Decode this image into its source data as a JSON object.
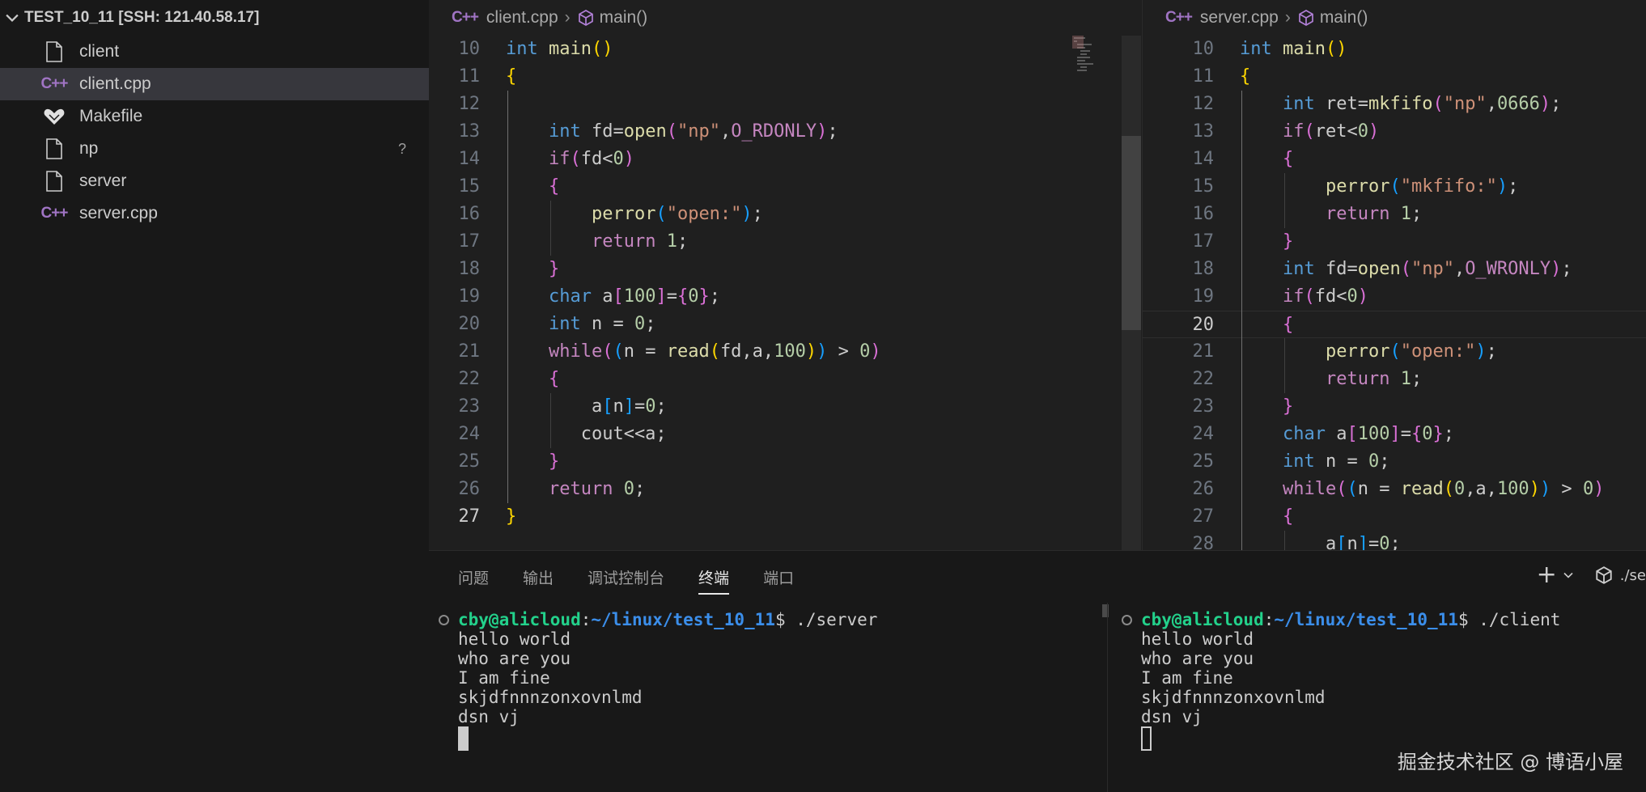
{
  "explorer": {
    "folder_title": "TEST_10_11 [SSH: 121.40.58.17]",
    "files": [
      {
        "name": "client",
        "icon": "file-icon"
      },
      {
        "name": "client.cpp",
        "icon": "cpp-icon"
      },
      {
        "name": "Makefile",
        "icon": "makefile-icon"
      },
      {
        "name": "np",
        "icon": "file-icon",
        "status": "?"
      },
      {
        "name": "server",
        "icon": "file-icon"
      },
      {
        "name": "server.cpp",
        "icon": "cpp-icon"
      }
    ]
  },
  "editor_left": {
    "breadcrumb_file": "client.cpp",
    "breadcrumb_symbol": "main()",
    "lines": [
      {
        "n": "10",
        "segs": [
          [
            "k",
            "int"
          ],
          [
            "p",
            " "
          ],
          [
            "f",
            "main"
          ],
          [
            "b1",
            "()"
          ]
        ]
      },
      {
        "n": "11",
        "segs": [
          [
            "b1",
            "{"
          ]
        ]
      },
      {
        "n": "12",
        "segs": []
      },
      {
        "n": "13",
        "segs": [
          [
            "p",
            "    "
          ],
          [
            "k",
            "int"
          ],
          [
            "p",
            " fd="
          ],
          [
            "f",
            "open"
          ],
          [
            "b2",
            "("
          ],
          [
            "s",
            "\"np\""
          ],
          [
            "p",
            ","
          ],
          [
            "m",
            "O_RDONLY"
          ],
          [
            "b2",
            ")"
          ],
          [
            "p",
            ";"
          ]
        ]
      },
      {
        "n": "14",
        "segs": [
          [
            "p",
            "    "
          ],
          [
            "c",
            "if"
          ],
          [
            "b2",
            "("
          ],
          [
            "p",
            "fd<"
          ],
          [
            "n",
            "0"
          ],
          [
            "b2",
            ")"
          ]
        ]
      },
      {
        "n": "15",
        "segs": [
          [
            "p",
            "    "
          ],
          [
            "b2",
            "{"
          ]
        ]
      },
      {
        "n": "16",
        "segs": [
          [
            "p",
            "        "
          ],
          [
            "f",
            "perror"
          ],
          [
            "b3",
            "("
          ],
          [
            "s",
            "\"open:\""
          ],
          [
            "b3",
            ")"
          ],
          [
            "p",
            ";"
          ]
        ]
      },
      {
        "n": "17",
        "segs": [
          [
            "p",
            "        "
          ],
          [
            "c",
            "return"
          ],
          [
            "p",
            " "
          ],
          [
            "n",
            "1"
          ],
          [
            "p",
            ";"
          ]
        ]
      },
      {
        "n": "18",
        "segs": [
          [
            "p",
            "    "
          ],
          [
            "b2",
            "}"
          ]
        ]
      },
      {
        "n": "19",
        "segs": [
          [
            "p",
            "    "
          ],
          [
            "k",
            "char"
          ],
          [
            "p",
            " a"
          ],
          [
            "b2",
            "["
          ],
          [
            "n",
            "100"
          ],
          [
            "b2",
            "]"
          ],
          [
            "p",
            "="
          ],
          [
            "b2",
            "{"
          ],
          [
            "n",
            "0"
          ],
          [
            "b2",
            "}"
          ],
          [
            "p",
            ";"
          ]
        ]
      },
      {
        "n": "20",
        "segs": [
          [
            "p",
            "    "
          ],
          [
            "k",
            "int"
          ],
          [
            "p",
            " n = "
          ],
          [
            "n",
            "0"
          ],
          [
            "p",
            ";"
          ]
        ]
      },
      {
        "n": "21",
        "segs": [
          [
            "p",
            "    "
          ],
          [
            "c",
            "while"
          ],
          [
            "b2",
            "("
          ],
          [
            "b3",
            "("
          ],
          [
            "p",
            "n = "
          ],
          [
            "f",
            "read"
          ],
          [
            "b1",
            "("
          ],
          [
            "p",
            "fd,a,"
          ],
          [
            "n",
            "100"
          ],
          [
            "b1",
            ")"
          ],
          [
            "b3",
            ")"
          ],
          [
            "p",
            " > "
          ],
          [
            "n",
            "0"
          ],
          [
            "b2",
            ")"
          ]
        ]
      },
      {
        "n": "22",
        "segs": [
          [
            "p",
            "    "
          ],
          [
            "b2",
            "{"
          ]
        ]
      },
      {
        "n": "23",
        "segs": [
          [
            "p",
            "        a"
          ],
          [
            "b3",
            "["
          ],
          [
            "p",
            "n"
          ],
          [
            "b3",
            "]"
          ],
          [
            "p",
            "="
          ],
          [
            "n",
            "0"
          ],
          [
            "p",
            ";"
          ]
        ]
      },
      {
        "n": "24",
        "segs": [
          [
            "p",
            "       cout<<a;"
          ]
        ]
      },
      {
        "n": "25",
        "segs": [
          [
            "p",
            "    "
          ],
          [
            "b2",
            "}"
          ]
        ]
      },
      {
        "n": "26",
        "segs": [
          [
            "p",
            "    "
          ],
          [
            "c",
            "return"
          ],
          [
            "p",
            " "
          ],
          [
            "n",
            "0"
          ],
          [
            "p",
            ";"
          ]
        ]
      },
      {
        "n": "27",
        "segs": [
          [
            "b1",
            "}"
          ]
        ]
      }
    ]
  },
  "editor_right": {
    "breadcrumb_file": "server.cpp",
    "breadcrumb_symbol": "main()",
    "lines": [
      {
        "n": "10",
        "segs": [
          [
            "k",
            "int"
          ],
          [
            "p",
            " "
          ],
          [
            "f",
            "main"
          ],
          [
            "b1",
            "()"
          ]
        ]
      },
      {
        "n": "11",
        "segs": [
          [
            "b1",
            "{"
          ]
        ]
      },
      {
        "n": "12",
        "segs": [
          [
            "p",
            "    "
          ],
          [
            "k",
            "int"
          ],
          [
            "p",
            " ret="
          ],
          [
            "f",
            "mkfifo"
          ],
          [
            "b2",
            "("
          ],
          [
            "s",
            "\"np\""
          ],
          [
            "p",
            ","
          ],
          [
            "n",
            "0666"
          ],
          [
            "b2",
            ")"
          ],
          [
            "p",
            ";"
          ]
        ]
      },
      {
        "n": "13",
        "segs": [
          [
            "p",
            "    "
          ],
          [
            "c",
            "if"
          ],
          [
            "b2",
            "("
          ],
          [
            "p",
            "ret<"
          ],
          [
            "n",
            "0"
          ],
          [
            "b2",
            ")"
          ]
        ]
      },
      {
        "n": "14",
        "segs": [
          [
            "p",
            "    "
          ],
          [
            "b2",
            "{"
          ]
        ]
      },
      {
        "n": "15",
        "segs": [
          [
            "p",
            "        "
          ],
          [
            "f",
            "perror"
          ],
          [
            "b3",
            "("
          ],
          [
            "s",
            "\"mkfifo:\""
          ],
          [
            "b3",
            ")"
          ],
          [
            "p",
            ";"
          ]
        ]
      },
      {
        "n": "16",
        "segs": [
          [
            "p",
            "        "
          ],
          [
            "c",
            "return"
          ],
          [
            "p",
            " "
          ],
          [
            "n",
            "1"
          ],
          [
            "p",
            ";"
          ]
        ]
      },
      {
        "n": "17",
        "segs": [
          [
            "p",
            "    "
          ],
          [
            "b2",
            "}"
          ]
        ]
      },
      {
        "n": "18",
        "segs": [
          [
            "p",
            "    "
          ],
          [
            "k",
            "int"
          ],
          [
            "p",
            " fd="
          ],
          [
            "f",
            "open"
          ],
          [
            "b2",
            "("
          ],
          [
            "s",
            "\"np\""
          ],
          [
            "p",
            ","
          ],
          [
            "m",
            "O_WRONLY"
          ],
          [
            "b2",
            ")"
          ],
          [
            "p",
            ";"
          ]
        ]
      },
      {
        "n": "19",
        "segs": [
          [
            "p",
            "    "
          ],
          [
            "c",
            "if"
          ],
          [
            "b2",
            "("
          ],
          [
            "p",
            "fd<"
          ],
          [
            "n",
            "0"
          ],
          [
            "b2",
            ")"
          ]
        ]
      },
      {
        "n": "20",
        "segs": [
          [
            "p",
            "    "
          ],
          [
            "b2",
            "{"
          ]
        ]
      },
      {
        "n": "21",
        "segs": [
          [
            "p",
            "        "
          ],
          [
            "f",
            "perror"
          ],
          [
            "b3",
            "("
          ],
          [
            "s",
            "\"open:\""
          ],
          [
            "b3",
            ")"
          ],
          [
            "p",
            ";"
          ]
        ]
      },
      {
        "n": "22",
        "segs": [
          [
            "p",
            "        "
          ],
          [
            "c",
            "return"
          ],
          [
            "p",
            " "
          ],
          [
            "n",
            "1"
          ],
          [
            "p",
            ";"
          ]
        ]
      },
      {
        "n": "23",
        "segs": [
          [
            "p",
            "    "
          ],
          [
            "b2",
            "}"
          ]
        ]
      },
      {
        "n": "24",
        "segs": [
          [
            "p",
            "    "
          ],
          [
            "k",
            "char"
          ],
          [
            "p",
            " a"
          ],
          [
            "b2",
            "["
          ],
          [
            "n",
            "100"
          ],
          [
            "b2",
            "]"
          ],
          [
            "p",
            "="
          ],
          [
            "b2",
            "{"
          ],
          [
            "n",
            "0"
          ],
          [
            "b2",
            "}"
          ],
          [
            "p",
            ";"
          ]
        ]
      },
      {
        "n": "25",
        "segs": [
          [
            "p",
            "    "
          ],
          [
            "k",
            "int"
          ],
          [
            "p",
            " n = "
          ],
          [
            "n",
            "0"
          ],
          [
            "p",
            ";"
          ]
        ]
      },
      {
        "n": "26",
        "segs": [
          [
            "p",
            "    "
          ],
          [
            "c",
            "while"
          ],
          [
            "b2",
            "("
          ],
          [
            "b3",
            "("
          ],
          [
            "p",
            "n = "
          ],
          [
            "f",
            "read"
          ],
          [
            "b1",
            "("
          ],
          [
            "n",
            "0"
          ],
          [
            "p",
            ",a,"
          ],
          [
            "n",
            "100"
          ],
          [
            "b1",
            ")"
          ],
          [
            "b3",
            ")"
          ],
          [
            "p",
            " > "
          ],
          [
            "n",
            "0"
          ],
          [
            "b2",
            ")"
          ]
        ]
      },
      {
        "n": "27",
        "segs": [
          [
            "p",
            "    "
          ],
          [
            "b2",
            "{"
          ]
        ]
      },
      {
        "n": "28",
        "segs": [
          [
            "p",
            "        a"
          ],
          [
            "b3",
            "["
          ],
          [
            "p",
            "n"
          ],
          [
            "b3",
            "]"
          ],
          [
            "p",
            "="
          ],
          [
            "n",
            "0"
          ],
          [
            "p",
            ";"
          ]
        ]
      }
    ]
  },
  "panel": {
    "tabs": [
      "问题",
      "输出",
      "调试控制台",
      "终端",
      "端口"
    ],
    "active_tab": "终端",
    "actions": {
      "add": "+",
      "profile": "./se"
    }
  },
  "terminal_left": {
    "user": "cby@alicloud",
    "path": "~/linux/test_10_11",
    "command": "$ ./server",
    "output": [
      "hello world",
      "who are you",
      "I am fine",
      "skjdfnnnzonxovnlmd",
      "dsn vj"
    ]
  },
  "terminal_right": {
    "user": "cby@alicloud",
    "path": "~/linux/test_10_11",
    "command": "$ ./client",
    "output": [
      "hello world",
      "who are you",
      "I am fine",
      "skjdfnnnzonxovnlmd",
      "dsn vj"
    ]
  },
  "watermark": "掘金技术社区 @ 博语小屋",
  "colors": {
    "keyword": "#569cd6",
    "control": "#c586c0",
    "function": "#dcdcaa",
    "string": "#ce9178",
    "number": "#b5cea8",
    "prompt_user": "#23d18b",
    "prompt_path": "#3b8eea"
  }
}
